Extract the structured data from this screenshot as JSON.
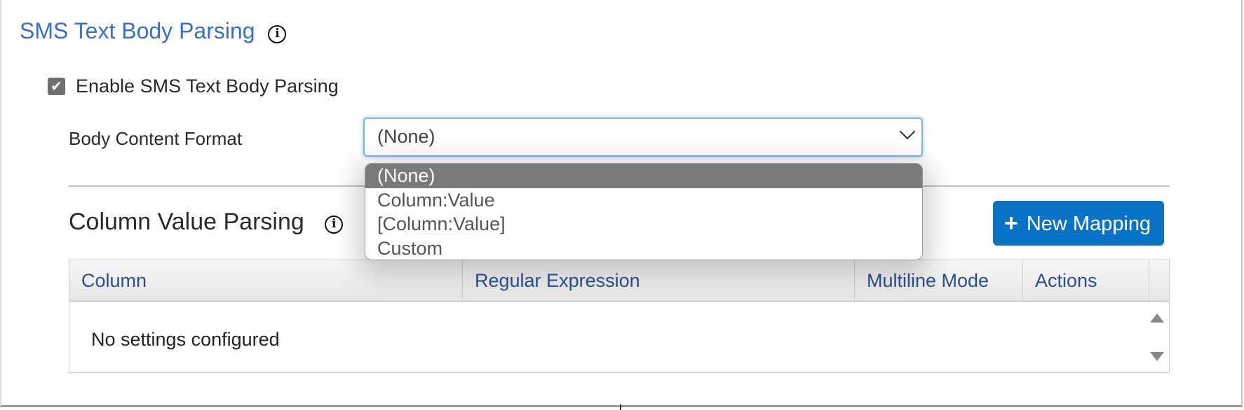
{
  "section": {
    "title": "SMS Text Body Parsing",
    "info_icon": "info-icon"
  },
  "enable_checkbox": {
    "checked": true,
    "label": "Enable SMS Text Body Parsing"
  },
  "body_content_format": {
    "label": "Body Content Format",
    "selected": "(None)",
    "options": [
      "(None)",
      "Column:Value",
      "[Column:Value]",
      "Custom"
    ],
    "highlighted_index": 0
  },
  "column_value_parsing": {
    "title": "Column Value Parsing",
    "info_icon": "info-icon",
    "new_mapping_label": "New Mapping",
    "new_mapping_icon": "plus-icon"
  },
  "grid": {
    "headers": [
      "Column",
      "Regular Expression",
      "Multiline Mode",
      "Actions"
    ],
    "empty_message": "No settings configured"
  },
  "colors": {
    "title_blue": "#3a6fc4",
    "button_blue": "#0a73c6",
    "header_text": "#2e4f8e",
    "selected_option_bg": "#7a7a7a"
  }
}
